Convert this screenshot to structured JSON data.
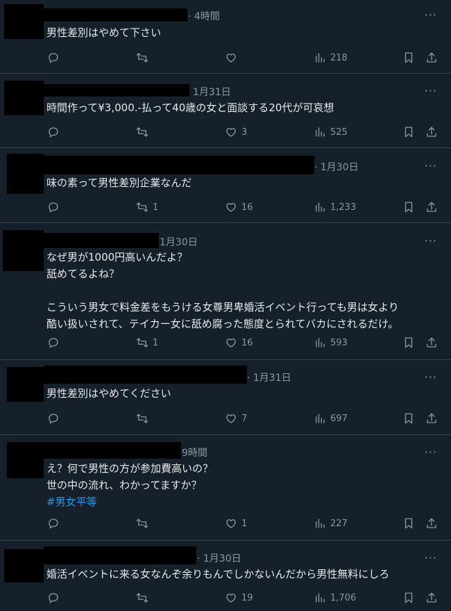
{
  "posts": [
    {
      "time": "· 4時間",
      "text": "男性差別はやめて下さい",
      "replies": "",
      "reposts": "",
      "likes": "",
      "views": "218"
    },
    {
      "time": "1月31日",
      "text": "時間作って¥3,000.-払って40歳の女と面談する20代が可哀想",
      "replies": "",
      "reposts": "",
      "likes": "3",
      "views": "525"
    },
    {
      "time": "· 1月30日",
      "text": "味の素って男性差別企業なんだ",
      "replies": "",
      "reposts": "1",
      "likes": "16",
      "views": "1,233"
    },
    {
      "time": "1月30日",
      "text": "なぜ男が1000円高いんだよ？\n舐めてるよね？\n\nこういう男女で料金差をもうける女尊男卑婚活イベント行っても男は女より\n酷い扱いされて、テイカー女に舐め腐った態度とられてバカにされるだけ。",
      "replies": "",
      "reposts": "1",
      "likes": "16",
      "views": "593"
    },
    {
      "time": "· 1月31日",
      "text": "男性差別はやめてください",
      "replies": "",
      "reposts": "",
      "likes": "7",
      "views": "697"
    },
    {
      "time": "9時間",
      "text": "え？何で男性の方が参加費高いの？\n世の中の流れ、わかってますか？",
      "hashtag": "#男女平等",
      "replies": "",
      "reposts": "",
      "likes": "1",
      "views": "227"
    },
    {
      "time": "· 1月30日",
      "text": "婚活イベントに来る女なんぞ余りもんでしかないんだから男性無料にしろ",
      "replies": "",
      "reposts": "",
      "likes": "19",
      "views": "1,706"
    }
  ],
  "more_label": "···"
}
